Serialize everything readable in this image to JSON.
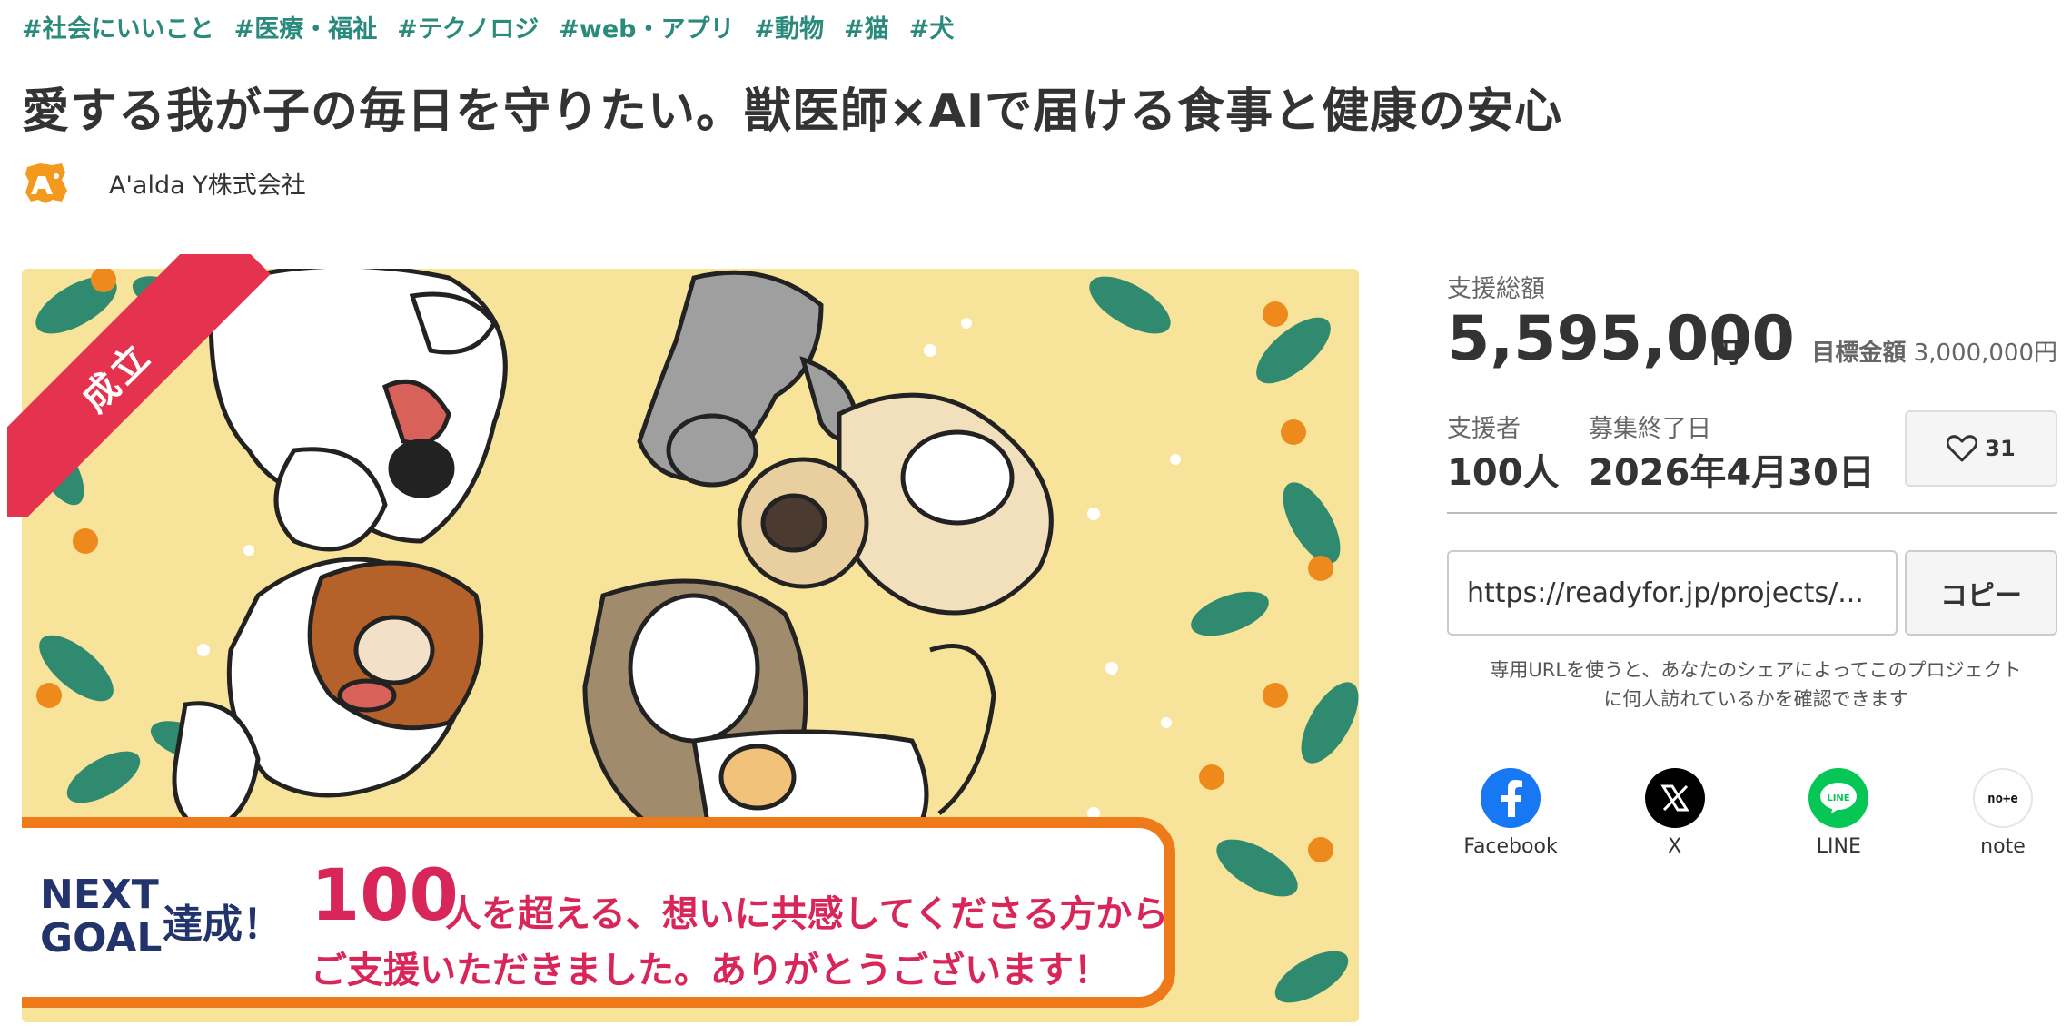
{
  "tags": [
    "#社会にいいこと",
    "#医療・福祉",
    "#テクノロジ",
    "#web・アプリ",
    "#動物",
    "#猫",
    "#犬"
  ],
  "title": "愛する我が子の毎日を守りたい。獣医師×AIで届ける食事と健康の安心",
  "owner": {
    "name": "A'alda Y株式会社"
  },
  "hero": {
    "badge": "成立",
    "goal_next": "NEXT\nGOAL",
    "goal_achieved": "達成！",
    "goal_number": "100",
    "goal_line1": "人を超える、想いに共感してくださる方から",
    "goal_line2": "ご支援いただきました。ありがとうございます！"
  },
  "stats": {
    "total_label": "支援総額",
    "total_value": "5,595,000",
    "total_unit": "円",
    "target_label": "目標金額",
    "target_value": "3,000,000円",
    "supporters_label": "支援者",
    "supporters_value": "100人",
    "end_label": "募集終了日",
    "end_value": "2026年4月30日",
    "favorites": "31"
  },
  "share_url": {
    "value": "https://readyfor.jp/projects/...",
    "copy_label": "コピー",
    "note": "専用URLを使うと、あなたのシェアによってこのプロジェクトに何人訪れているかを確認できます"
  },
  "shares": [
    {
      "label": "Facebook",
      "icon": "facebook-icon",
      "color": "#1877f2"
    },
    {
      "label": "X",
      "icon": "x-icon",
      "color": "#000000"
    },
    {
      "label": "LINE",
      "icon": "line-icon",
      "color": "#06c755"
    },
    {
      "label": "note",
      "icon": "note-icon",
      "color": "#ffffff"
    }
  ],
  "colors": {
    "tag": "#2a8a7c",
    "badge": "#e5334f",
    "goal_border": "#ee7a1a",
    "goal_accent": "#d9265a",
    "goal_navy": "#23336b"
  }
}
